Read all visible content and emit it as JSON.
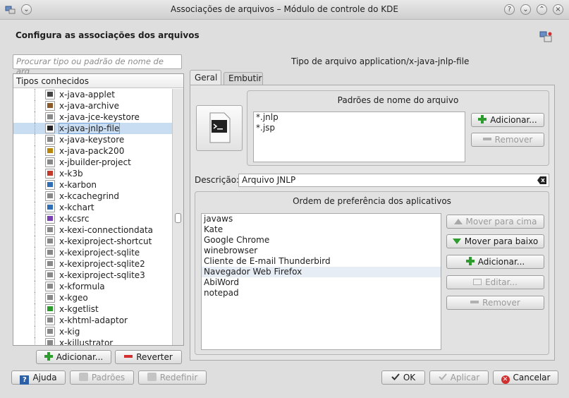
{
  "window": {
    "title": "Associações de arquivos – Módulo de controle do KDE",
    "help_button": "?",
    "minimize_button": "⌄",
    "maximize_button": "⌃",
    "close_button": "×"
  },
  "header": {
    "title": "Configura as associações dos arquivos"
  },
  "left": {
    "search_placeholder": "Procurar tipo ou padrão de nome de arq",
    "tree_header": "Tipos conhecidos",
    "items": [
      {
        "label": "x-java-applet",
        "icon_color": "#444444"
      },
      {
        "label": "x-java-archive",
        "icon_color": "#8b5a2b"
      },
      {
        "label": "x-java-jce-keystore",
        "icon_color": "#888888"
      },
      {
        "label": "x-java-jnlp-file",
        "icon_color": "#222222",
        "selected": true
      },
      {
        "label": "x-java-keystore",
        "icon_color": "#888888"
      },
      {
        "label": "x-java-pack200",
        "icon_color": "#b8860b"
      },
      {
        "label": "x-jbuilder-project",
        "icon_color": "#888888"
      },
      {
        "label": "x-k3b",
        "icon_color": "#c0392b"
      },
      {
        "label": "x-karbon",
        "icon_color": "#2f6db5"
      },
      {
        "label": "x-kcachegrind",
        "icon_color": "#888888"
      },
      {
        "label": "x-kchart",
        "icon_color": "#2f6db5"
      },
      {
        "label": "x-kcsrc",
        "icon_color": "#7a3fb0"
      },
      {
        "label": "x-kexi-connectiondata",
        "icon_color": "#888888"
      },
      {
        "label": "x-kexiproject-shortcut",
        "icon_color": "#888888"
      },
      {
        "label": "x-kexiproject-sqlite",
        "icon_color": "#888888"
      },
      {
        "label": "x-kexiproject-sqlite2",
        "icon_color": "#888888"
      },
      {
        "label": "x-kexiproject-sqlite3",
        "icon_color": "#888888"
      },
      {
        "label": "x-kformula",
        "icon_color": "#888888"
      },
      {
        "label": "x-kgeo",
        "icon_color": "#888888"
      },
      {
        "label": "x-kgetlist",
        "icon_color": "#2e9b2e"
      },
      {
        "label": "x-khtml-adaptor",
        "icon_color": "#888888"
      },
      {
        "label": "x-kig",
        "icon_color": "#888888"
      },
      {
        "label": "x-killustrator",
        "icon_color": "#888888"
      }
    ],
    "add_button": "Adicionar...",
    "revert_button": "Reverter"
  },
  "right": {
    "type_title": "Tipo de arquivo application/x-java-jnlp-file",
    "tabs": [
      "Geral",
      "Embutir"
    ],
    "patterns_group_title": "Padrões de nome do arquivo",
    "patterns": [
      "*.jnlp",
      "*.jsp"
    ],
    "patterns_add": "Adicionar...",
    "patterns_remove": "Remover",
    "description_label": "Descrição:",
    "description_value": "Arquivo JNLP",
    "apps_group_title": "Ordem de preferência dos aplicativos",
    "apps": [
      "javaws",
      "Kate",
      "Google Chrome",
      "winebrowser",
      "Cliente de E-mail Thunderbird",
      "Navegador Web Firefox",
      "AbiWord",
      "notepad"
    ],
    "apps_move_up": "Mover para cima",
    "apps_move_down": "Mover para baixo",
    "apps_add": "Adicionar...",
    "apps_edit": "Editar...",
    "apps_remove": "Remover"
  },
  "footer": {
    "help": "Ajuda",
    "defaults": "Padrões",
    "reset": "Redefinir",
    "ok": "OK",
    "apply": "Aplicar",
    "cancel": "Cancelar"
  },
  "colors": {
    "accent_green": "#2e9b2e",
    "accent_red": "#d23030",
    "selection": "#c8dcf2"
  }
}
